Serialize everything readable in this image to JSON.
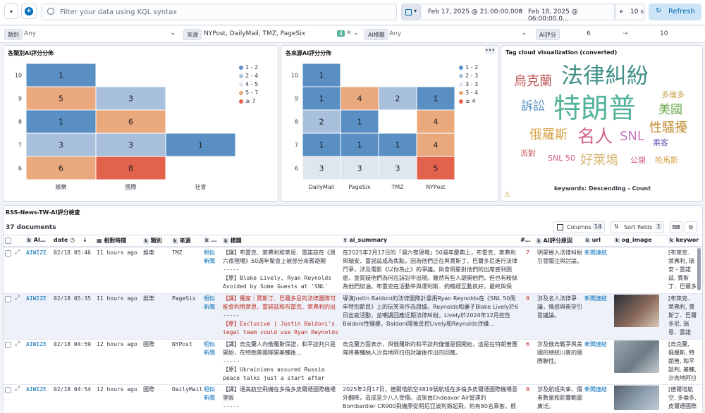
{
  "topbar": {
    "query_placeholder": "Filter your data using KQL syntax",
    "date_start": "Feb 17, 2025 @ 21:00:00.000",
    "date_arrow": "→",
    "date_end": "Feb 18, 2025 @ 06:00:00.0…",
    "refresh_interval": "10 s",
    "refresh_label": "Refresh"
  },
  "filters": {
    "category_label": "類別",
    "category_value": "Any",
    "source_label": "來源",
    "source_value": "NYPost, DailyMail, TMZ, PageSix",
    "source_count": "4",
    "tag_label": "AI標籤",
    "tag_value": "Any",
    "score_label": "AI評分",
    "score_min": "6",
    "score_arrow": "→",
    "score_max": "10"
  },
  "heatmap1": {
    "title": "各類別AI評分分佈",
    "legend": [
      {
        "label": "1 - 2",
        "color": "#5a8fc4"
      },
      {
        "label": "2 - 4",
        "color": "#a8c0dc"
      },
      {
        "label": "4 - 5",
        "color": "#dfe6f0"
      },
      {
        "label": "5 - 7",
        "color": "#e9a97c"
      },
      {
        "label": "≥ 7",
        "color": "#e2624c"
      }
    ]
  },
  "heatmap2": {
    "title": "各來源AI評分分佈",
    "legend": [
      {
        "label": "1 - 2",
        "color": "#5a8fc4"
      },
      {
        "label": "2 - 3",
        "color": "#a8c0dc"
      },
      {
        "label": "3 - 3",
        "color": "#dfe6f0"
      },
      {
        "label": "3 - 4",
        "color": "#e9a97c"
      },
      {
        "label": "≥ 4",
        "color": "#e2624c"
      }
    ]
  },
  "chart_data": [
    {
      "type": "heatmap",
      "title": "各類別AI評分分佈",
      "x_categories": [
        "娛樂",
        "國際",
        "社會"
      ],
      "y_categories": [
        "10",
        "9",
        "8",
        "7",
        "6"
      ],
      "cells": [
        {
          "x": "娛樂",
          "y": "10",
          "value": 1
        },
        {
          "x": "娛樂",
          "y": "9",
          "value": 5
        },
        {
          "x": "國際",
          "y": "9",
          "value": 3
        },
        {
          "x": "娛樂",
          "y": "8",
          "value": 1
        },
        {
          "x": "國際",
          "y": "8",
          "value": 6
        },
        {
          "x": "娛樂",
          "y": "7",
          "value": 3
        },
        {
          "x": "國際",
          "y": "7",
          "value": 3
        },
        {
          "x": "社會",
          "y": "7",
          "value": 1
        },
        {
          "x": "娛樂",
          "y": "6",
          "value": 6
        },
        {
          "x": "國際",
          "y": "6",
          "value": 8
        }
      ]
    },
    {
      "type": "heatmap",
      "title": "各來源AI評分分佈",
      "x_categories": [
        "DailyMail",
        "PageSix",
        "TMZ",
        "NYPost"
      ],
      "y_categories": [
        "10",
        "9",
        "8",
        "7",
        "6"
      ],
      "cells": [
        {
          "x": "DailyMail",
          "y": "10",
          "value": 1
        },
        {
          "x": "DailyMail",
          "y": "9",
          "value": 1
        },
        {
          "x": "PageSix",
          "y": "9",
          "value": 4
        },
        {
          "x": "TMZ",
          "y": "9",
          "value": 2
        },
        {
          "x": "NYPost",
          "y": "9",
          "value": 1
        },
        {
          "x": "DailyMail",
          "y": "8",
          "value": 2
        },
        {
          "x": "PageSix",
          "y": "8",
          "value": 1
        },
        {
          "x": "NYPost",
          "y": "8",
          "value": 4
        },
        {
          "x": "DailyMail",
          "y": "7",
          "value": 1
        },
        {
          "x": "PageSix",
          "y": "7",
          "value": 1
        },
        {
          "x": "TMZ",
          "y": "7",
          "value": 1
        },
        {
          "x": "NYPost",
          "y": "7",
          "value": 4
        },
        {
          "x": "DailyMail",
          "y": "6",
          "value": 3
        },
        {
          "x": "PageSix",
          "y": "6",
          "value": 3
        },
        {
          "x": "TMZ",
          "y": "6",
          "value": 3
        },
        {
          "x": "NYPost",
          "y": "6",
          "value": 5
        }
      ]
    }
  ],
  "tagcloud": {
    "title": "Tag cloud visualization (converted)",
    "footer": "keywords: Descending - Count",
    "words": [
      {
        "text": "法律糾紛",
        "color": "#3f8f86"
      },
      {
        "text": "烏克蘭",
        "color": "#c25a5a"
      },
      {
        "text": "特朗普",
        "color": "#54b399"
      },
      {
        "text": "訴訟",
        "color": "#5a8fc4"
      },
      {
        "text": "多倫多",
        "color": "#c9a04a"
      },
      {
        "text": "美國",
        "color": "#6ba84f"
      },
      {
        "text": "俄羅斯",
        "color": "#d6a246"
      },
      {
        "text": "名人",
        "color": "#d36086"
      },
      {
        "text": "SNL",
        "color": "#c57ac1"
      },
      {
        "text": "性騷擾",
        "color": "#c28e33"
      },
      {
        "text": "乘客",
        "color": "#6e5bb8"
      },
      {
        "text": "派對",
        "color": "#c25a5a"
      },
      {
        "text": "SNL 50",
        "color": "#d36086"
      },
      {
        "text": "好萊塢",
        "color": "#d6b36b"
      },
      {
        "text": "公開",
        "color": "#d36086"
      },
      {
        "text": "哈馬斯",
        "color": "#d6a246"
      }
    ]
  },
  "table": {
    "title": "RSS-News-TW-AI評分檢查",
    "doc_count": "37 documents",
    "columns_label": "Columns",
    "columns_count": "14",
    "sort_label": "Sort fields",
    "sort_count": "1",
    "headers": [
      "AI…",
      "date",
      "相對時間",
      "類別",
      "來源",
      "…",
      "標題",
      "ai_summary",
      "#…",
      "AI評分原因",
      "url",
      "og_image",
      "keywor"
    ],
    "rows": [
      {
        "ai": "AIWIZE",
        "date": "02/18 05:46",
        "rel": "11 hours ago",
        "cat": "娛樂",
        "src": "TMZ",
        "sim": "相似新聞",
        "title1": "【譯】布雷克．萊弗利和萊恩．雷諾茲在《周六夜現場》50週年聚會上被部分來賓避開",
        "sep": "-----",
        "title2": "【原】Blake Lively, Ryan Reynolds Avoided by Some Guests at 'SNL' 50th",
        "summary": "在2025年2月17日的「週六夜現場」50週年慶典上，布雷克．萊弗利與瑞安．雷諾茲成為焦點，因為他們正在與賈斯丁．巴爾多尼進行法律鬥爭，涉及電影《以你為止》的爭議。與會明星對他們的出席感到困惑，並質疑他們為何在訴訟中出現。雖然有些人避開他們，但也有粉絲為他們加油。布雷克在活動中與運利斯．約翰遜互動良好，最終與保羅．麥卡特尼…",
        "score": "7",
        "reason": "明星捲入法律糾紛引發關注與討論。",
        "url": "新聞連結",
        "kw": "[布萊克．萊弗利, 瑞安・雷諾茲, 賈斯丁．巴爾多尼, JUSTIN …"
      },
      {
        "ai": "AIWIZE",
        "date": "02/18 05:35",
        "rel": "11 hours ago",
        "cat": "娛樂",
        "src": "PageSix",
        "sim": "相似新聞",
        "title1": "【譯】獨家｜賈斯汀．巴爾多尼的法律團隊可能會利用萊恩．雷諾茲和布雷克．萊弗利的出現…",
        "sep": "-----",
        "title2": "【原】Exclusive | Justin Baldoni's legal team could use Ryan Reynolds …",
        "summary": "導演Justin Baldoni的法律團隊計畫用Ryan Reynolds在《SNL 50周年特別節目》上的玩笑來作為證據。Reynolds和妻子Blake Lively於6日出庭活動，並嘲諷回應近期法律糾紛。Lively於2024年12月控告Baldoni性騷擾，Baldoni隨後反控Lively和Reynolds涉嫌…",
        "score": "9",
        "reason": "涉及名人法律爭議，情感與衝突引發議論。",
        "url": "新聞連結",
        "kw": "[布萊克．萊弗利, 賈斯丁．巴爾多尼, 瑞恩．雷諾茲, 訴訟, 性騷擾, 法律糾紛…"
      },
      {
        "ai": "AIWIZE",
        "date": "02/18 04:59",
        "rel": "12 hours ago",
        "cat": "國際",
        "src": "NYPost",
        "sim": "相似新聞",
        "title1": "【譯】烏克蘭人向俄羅斯保證，和平談判只是開始，在特朗普團隊開基輔後…",
        "sep": "-----",
        "title2": "【原】Ukrainians assured Russia peace talks just a start after Trump …",
        "summary": "烏克蘭方面表示，與俄羅斯的和平談判僅僅是個開始，這是在特朗普團隊將基輔納入沙烏地阿拉伯討論後作出的回應。",
        "score": "6",
        "reason": "涉及俄烏戰爭與美國的總統川普的國際聯性。",
        "url": "新聞連結",
        "kw": "[烏克蘭, 俄羅斯, 特朗普, 和平談判, 基輔, 沙烏地阿拉伯]"
      },
      {
        "ai": "AIWIZE",
        "date": "02/18 04:54",
        "rel": "12 hours ago",
        "cat": "國際",
        "src": "DailyMail",
        "sim": "相似新聞",
        "title1": "【譯】達美航空飛機在多倫多皮爾遜國際機場墜毀",
        "sep": "-----",
        "title2": "【原】Delta plane crashes at Toronto",
        "summary": "2025年2月17日，德爾塔航空4819號航班在多倫多皮爾遜國際機場意外翻降，造成至少八人受傷。這架由Endeavor Air營運的Bombardier CR900飛機原從明尼亞波利斯起飛，約有80名乘客。根據加拿大當局報",
        "score": "8",
        "reason": "涉及航班失事，傷者數量和影響範圍廣泛。",
        "url": "新聞連結",
        "kw": "[德爾塔航空, 多倫多, 皮爾遜國際機場, 墜…"
      }
    ]
  }
}
